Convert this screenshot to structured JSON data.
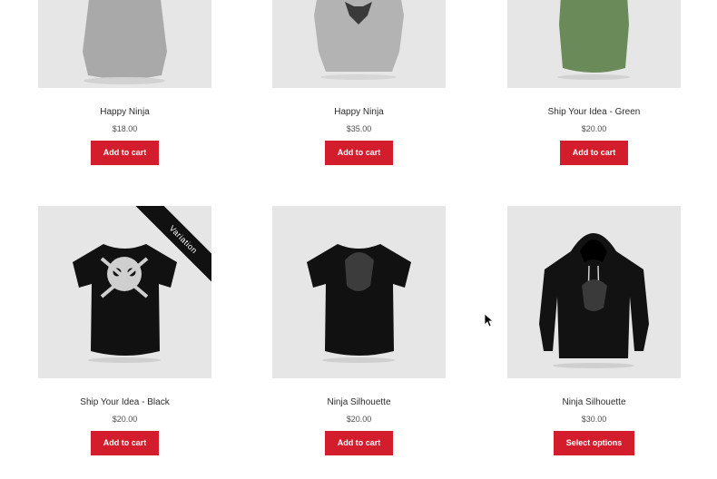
{
  "products": [
    {
      "title": "Happy Ninja",
      "price": "$18.00",
      "button": "Add to cart",
      "image": "grey-tshirt",
      "color": "#a9a9a9"
    },
    {
      "title": "Happy Ninja",
      "price": "$35.00",
      "button": "Add to cart",
      "image": "grey-hoodie",
      "color": "#b3b3b3"
    },
    {
      "title": "Ship Your Idea - Green",
      "price": "$20.00",
      "button": "Add to cart",
      "image": "green-hoodie",
      "color": "#6b8a5a"
    },
    {
      "title": "Ship Your Idea - Black",
      "price": "$20.00",
      "button": "Add to cart",
      "image": "black-skull-tshirt",
      "color": "#111111",
      "badge": "Variation"
    },
    {
      "title": "Ninja Silhouette",
      "price": "$20.00",
      "button": "Add to cart",
      "image": "black-ninja-tshirt",
      "color": "#111111"
    },
    {
      "title": "Ninja Silhouette",
      "price": "$30.00",
      "button": "Select options",
      "image": "black-ninja-hoodie",
      "color": "#121212"
    }
  ],
  "colors": {
    "button": "#d31c2c",
    "thumbnail_bg": "#e6e6e6",
    "badge_bg": "#111111"
  }
}
